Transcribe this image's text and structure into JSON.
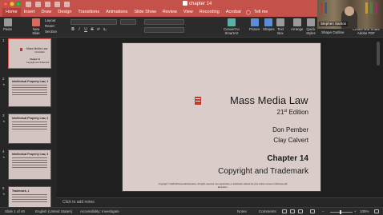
{
  "window": {
    "title": "chapter 14"
  },
  "ribbon_tabs": [
    "Home",
    "Insert",
    "Draw",
    "Design",
    "Transitions",
    "Animations",
    "Slide Show",
    "Review",
    "View",
    "Recording",
    "Acrobat"
  ],
  "tell_me": "Tell me",
  "active_tab": "Home",
  "ribbon": {
    "paste": "Paste",
    "new_slide": "New\nSlide",
    "layout": "Layout",
    "reset": "Reset",
    "section": "Section",
    "convert_smartart": "Convert to\nSmartArt",
    "picture": "Picture",
    "shapes": "Shapes",
    "text_box": "Text\nBox",
    "arrange": "Arrange",
    "quick_styles": "Quick\nStyles",
    "shape_fill": "Shape Fill",
    "shape_outline": "Shape Outline",
    "create_share_pdf": "Create and Share\nAdobe PDF",
    "format_buttons": [
      "B",
      "I",
      "U",
      "S",
      "x²",
      "x₂"
    ]
  },
  "video": {
    "name": "Stephen Santos"
  },
  "thumbnails": [
    {
      "num": "1",
      "title": "Mass Media Law",
      "subtitle": "21st Edition",
      "chapter": "Chapter 14",
      "topic": "Copyright and Trademark"
    },
    {
      "num": "2",
      "title": "Intellectual Property Law, 1"
    },
    {
      "num": "3",
      "title": "Intellectual Property Law, 2"
    },
    {
      "num": "4",
      "title": "Intellectual Property Law, 3"
    },
    {
      "num": "5",
      "title": "Trademark, 1"
    }
  ],
  "slide": {
    "title": "Mass Media Law",
    "edition_num": "21",
    "edition_sup": "st",
    "edition_word": " Edition",
    "author1": "Don Pember",
    "author2": "Clay Calvert",
    "chapter": "Chapter 14",
    "topic": "Copyright and Trademark",
    "copyright": "Copyright © 2020 McGraw-Hill Education. All rights reserved. No reproduction or distribution without the prior written consent of McGraw-Hill Education."
  },
  "notes": {
    "placeholder": "Click to add notes"
  },
  "status": {
    "slide_of": "Slide 1 of 40",
    "language": "English (United States)",
    "accessibility": "Accessibility: Investigate",
    "notes": "Notes",
    "comments": "Comments",
    "zoom": "105%"
  }
}
